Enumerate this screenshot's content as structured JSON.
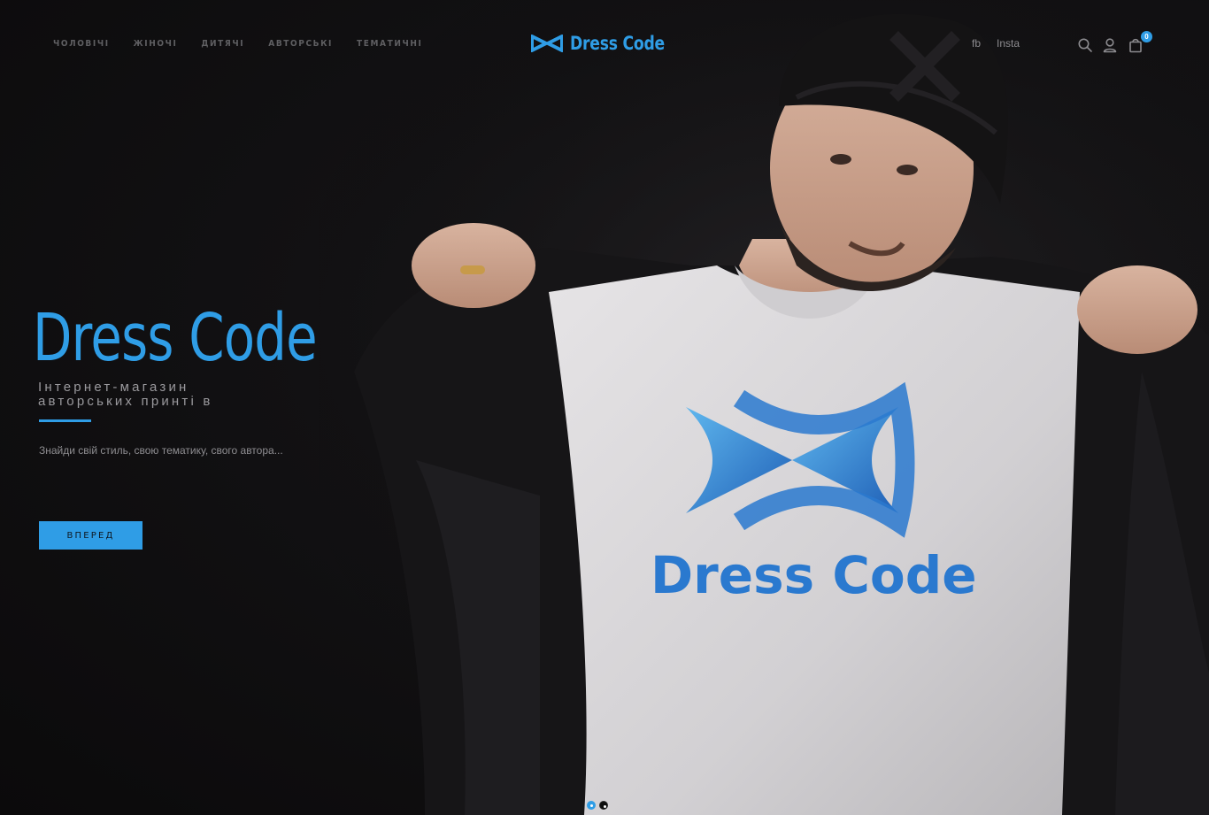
{
  "header": {
    "nav_items": [
      "чоловічі",
      "жіночі",
      "дитячі",
      "авторські",
      "тематичні"
    ],
    "brand_name": "Dress Code",
    "social": {
      "facebook": "fb",
      "instagram": "Insta"
    },
    "cart_count": "0"
  },
  "hero": {
    "title": "Dress Code",
    "subtitle": "Інтернет-магазин авторських принті в",
    "tagline": "Знайди свій стиль, свою тематику, свого автора...",
    "button_label": "ВПЕРЕД",
    "shirt_print": "Dress Code"
  },
  "slider": {
    "slides": 2,
    "active_index": 1
  },
  "colors": {
    "accent": "#2f9de6",
    "background": "#0e0d0e",
    "nav_text": "#5f5f62",
    "muted_text": "#9a999d"
  },
  "icons": [
    "search-icon",
    "user-icon",
    "shopping-bag-icon"
  ]
}
